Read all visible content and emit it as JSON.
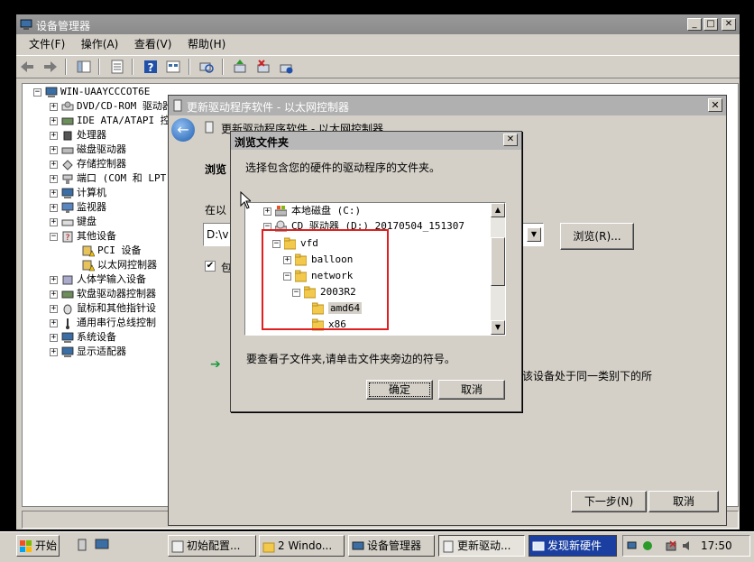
{
  "device_manager": {
    "title": "设备管理器",
    "menu": [
      "文件(F)",
      "操作(A)",
      "查看(V)",
      "帮助(H)"
    ],
    "tree": {
      "root": "WIN-UAAYCCCOT6E",
      "items": [
        "DVD/CD-ROM 驱动器",
        "IDE ATA/ATAPI 控",
        "处理器",
        "磁盘驱动器",
        "存储控制器",
        "端口 (COM 和 LPT",
        "计算机",
        "监视器",
        "键盘",
        "其他设备",
        "PCI 设备",
        "以太网控制器",
        "人体学输入设备",
        "软盘驱动器控制器",
        "鼠标和其他指针设",
        "通用串行总线控制",
        "系统设备",
        "显示适配器"
      ]
    }
  },
  "update_driver": {
    "title": "更新驱动程序软件 - 以太网控制器",
    "header": "更新驱动程序软件 - 以太网控制器",
    "browse_label": "浏览",
    "search_label": "在以",
    "path_value": "D:\\v",
    "include_label": "包",
    "browse_button": "浏览(R)...",
    "hint_text": "该设备处于同一类别下的所",
    "next_button": "下一步(N)",
    "cancel_button": "取消"
  },
  "browse_folder": {
    "title": "浏览文件夹",
    "prompt": "选择包含您的硬件的驱动程序的文件夹。",
    "tree": {
      "local_disk": "本地磁盘 (C:)",
      "cd_drive": "CD 驱动器 (D:) 20170504_151307",
      "vfd": "vfd",
      "balloon": "balloon",
      "network": "network",
      "os": "2003R2",
      "amd64": "amd64",
      "x86": "x86"
    },
    "hint": "要查看子文件夹,请单击文件夹旁边的符号。",
    "ok_button": "确定",
    "cancel_button": "取消"
  },
  "taskbar": {
    "start": "开始",
    "tasks": [
      "初始配置...",
      "2 Windo...",
      "设备管理器",
      "更新驱动...",
      "发现新硬件"
    ],
    "clock": "17:50"
  },
  "colors": {
    "highlight_box": "#e02020",
    "taskbar_active": "#1a3fa0",
    "back_arrow": "#1f5fb0"
  }
}
